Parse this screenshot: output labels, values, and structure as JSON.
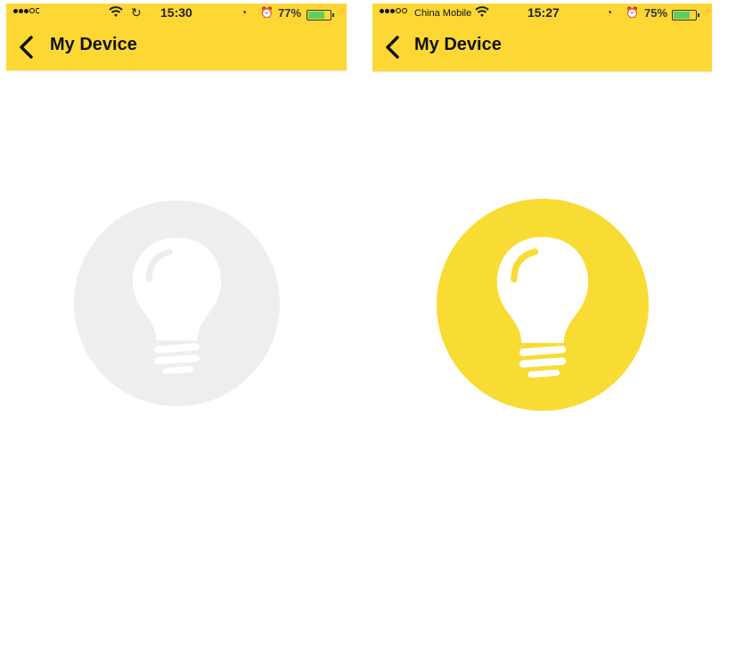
{
  "screens": [
    {
      "status": {
        "carrier": "",
        "time": "15:30",
        "battery_pct": "77%",
        "battery_level": 0.77,
        "has_sync_icon": true
      },
      "nav": {
        "title": "My Device"
      },
      "bulb": {
        "state": "off",
        "circle_color": "#eeeeee",
        "glyph_color": "#ffffff"
      }
    },
    {
      "status": {
        "carrier": "China Mobile",
        "time": "15:27",
        "battery_pct": "75%",
        "battery_level": 0.75,
        "has_sync_icon": false
      },
      "nav": {
        "title": "My Device"
      },
      "bulb": {
        "state": "on",
        "circle_color": "#f9dc33",
        "glyph_color": "#ffffff"
      }
    }
  ],
  "colors": {
    "header": "#fdd835",
    "battery_fill": "#59d15d"
  },
  "icons": [
    "back-chevron-icon",
    "wifi-icon",
    "sync-icon",
    "orientation-lock-icon",
    "alarm-icon",
    "battery-icon",
    "charging-bolt-icon",
    "lightbulb-icon"
  ]
}
